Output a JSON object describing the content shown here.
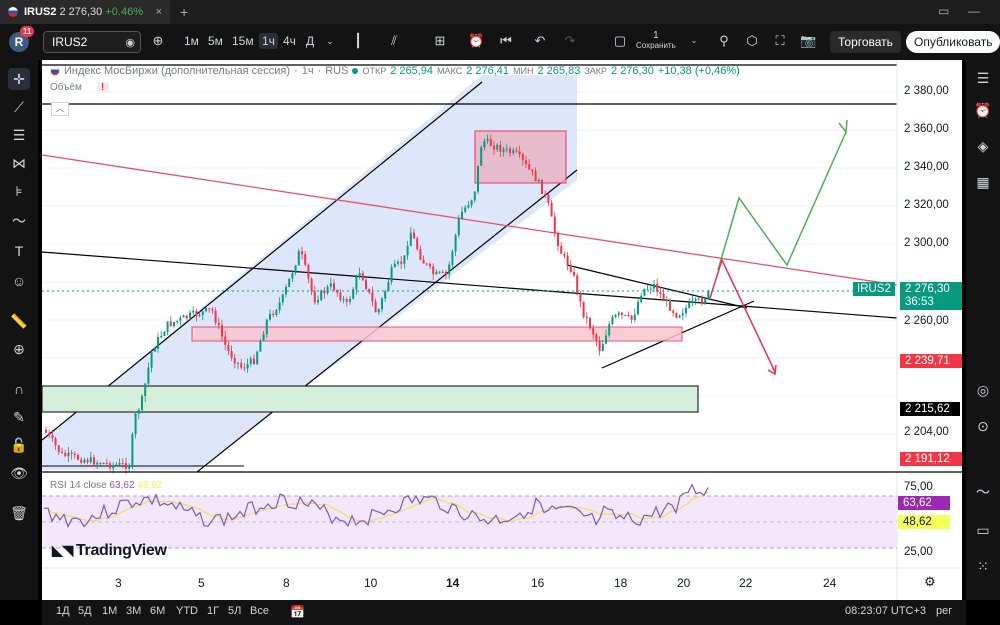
{
  "tab": {
    "symbol": "IRUS2",
    "price": "2 276,30",
    "change": "+0.46%",
    "close": "×"
  },
  "toolbar": {
    "avatar_letter": "R",
    "avatar_badge": "11",
    "symbol": "IRUS2",
    "intervals": [
      "1м",
      "5м",
      "15м",
      "1ч",
      "4ч",
      "Д"
    ],
    "selected_interval": "1ч",
    "save_count": "1",
    "save_label": "Сохранить",
    "trade_label": "Торговать",
    "publish_label": "Опубликовать"
  },
  "legend": {
    "title": "Индекс МосБиржи (дополнительная сессия)",
    "interval": "1ч",
    "exchange": "RUS",
    "open_label": "ОТКР",
    "open": "2 265,94",
    "high_label": "МАКС",
    "high": "2 276,41",
    "low_label": "МИН",
    "low": "2 265,83",
    "close_label": "ЗАКР",
    "close": "2 276,30",
    "change": "+10,38 (+0,46%)",
    "volume_label": "Объём",
    "volume_warn": "!"
  },
  "price_axis": {
    "labels": [
      "2 380,00",
      "2 360,00",
      "2 340,00",
      "2 320,00",
      "2 300,00",
      "2 260,00",
      "2 204,00"
    ],
    "current_symbol": "IRUS2",
    "current_price": "2 276,30",
    "countdown": "36:53",
    "level_red": "2 239,71",
    "level_black": "2 215,62",
    "level_red2": "2 191,12"
  },
  "rsi": {
    "name": "RSI 14 close",
    "value": "63,62",
    "ma_value": "48,62",
    "upper": "75,00",
    "lower": "25,00"
  },
  "time_axis": [
    "3",
    "5",
    "8",
    "10",
    "14",
    "16",
    "18",
    "20",
    "22",
    "24"
  ],
  "branding": "TradingView",
  "bottom": {
    "ranges": [
      "1Д",
      "5Д",
      "1М",
      "3М",
      "6М",
      "YTD",
      "1Г",
      "5Л",
      "Все"
    ],
    "clock": "08:23:07 UTC+3",
    "mode": "рег"
  },
  "colors": {
    "up": "#089981",
    "down": "#f23645",
    "channel": "#c9d6f7",
    "rsi_line": "#7e57c2",
    "rsi_ma": "#f5ee5a"
  }
}
